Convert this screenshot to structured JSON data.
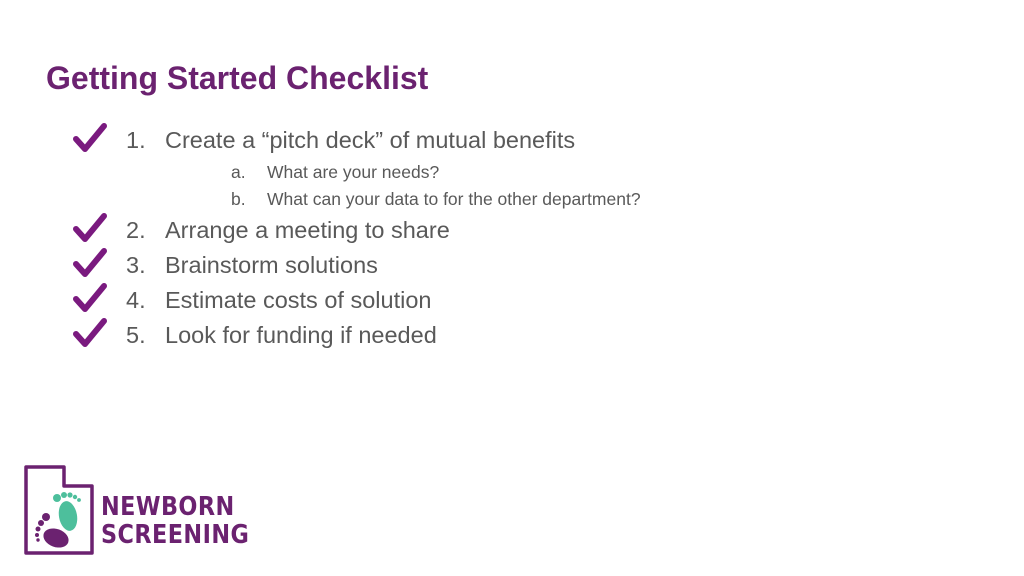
{
  "slide": {
    "title": "Getting Started Checklist",
    "accent_color": "#6b2270",
    "text_color": "#595959",
    "items": [
      {
        "number": "1.",
        "text": "Create a “pitch deck” of mutual benefits",
        "checked": true,
        "subitems": [
          {
            "letter": "a.",
            "text": "What are your needs?"
          },
          {
            "letter": "b.",
            "text": "What can your data to for the other department?"
          }
        ]
      },
      {
        "number": "2.",
        "text": "Arrange a meeting to share",
        "checked": true
      },
      {
        "number": "3.",
        "text": "Brainstorm solutions",
        "checked": true
      },
      {
        "number": "4.",
        "text": "Estimate costs of solution",
        "checked": true
      },
      {
        "number": "5.",
        "text": "Look for funding if needed",
        "checked": true
      }
    ]
  },
  "logo": {
    "line1": "NEWBORN",
    "line2": "SCREENING",
    "icon": "utah-footprints-icon",
    "colors": {
      "purple": "#6b2270",
      "teal": "#4dbf9c"
    }
  }
}
